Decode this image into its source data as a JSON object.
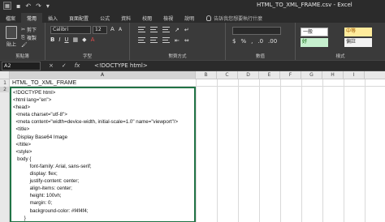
{
  "titlebar": {
    "app_icon": "excel-icon",
    "qat": [
      "save-icon",
      "undo-icon",
      "redo-icon",
      "customize-icon"
    ],
    "title": "HTML_TO_XML_FRAME.csv  -  Excel"
  },
  "tabs": {
    "items": [
      "檔案",
      "常用",
      "插入",
      "頁面配置",
      "公式",
      "資料",
      "校閱",
      "檢視",
      "說明"
    ],
    "active": "常用",
    "tell_me": "告訴我您想要執行什麼"
  },
  "ribbon": {
    "clipboard": {
      "paste": "貼上",
      "cut": "剪下",
      "copy": "複製",
      "label": "剪貼簿"
    },
    "font": {
      "name": "Calibri",
      "size": "12",
      "label": "字型",
      "bold": "B",
      "italic": "I",
      "underline": "U"
    },
    "alignment": {
      "label": "對齊方式"
    },
    "number": {
      "label": "數值"
    },
    "styles": {
      "label": "樣式",
      "normal": "一般",
      "neutral": "中等",
      "good": "好",
      "bad": "偏註"
    }
  },
  "formula_bar": {
    "name_box": "A2",
    "cancel": "×",
    "enter": "✓",
    "fx": "fx",
    "content": "<!DOCTYPE html>"
  },
  "grid": {
    "columns": [
      "A",
      "B",
      "C",
      "D",
      "E",
      "F",
      "G",
      "H",
      "I"
    ],
    "rows": [
      "1",
      "2"
    ],
    "cell_a1": "HTML_TO_XML_FRAME",
    "cell_a2_lines": [
      "<!DOCTYPE html>",
      "<html lang=\"en\">",
      "<head>",
      "  <meta charset=\"utf-8\">",
      "  <meta content=\"width=device-width, initial-scale=1.0\" name=\"viewport\"/>",
      "  <title>",
      "   Display Base64 Image",
      "  </title>",
      "  <style>",
      "   body {",
      "            font-family: Arial, sans-serif;",
      "            display: flex;",
      "            justify-content: center;",
      "            align-items: center;",
      "            height: 100vh;",
      "            margin: 0;",
      "            background-color: #f4f4f4;",
      "        }"
    ]
  },
  "colors": {
    "chrome_dark": "#2b2b2b",
    "ribbon": "#3a3a3a",
    "selection": "#217346"
  }
}
